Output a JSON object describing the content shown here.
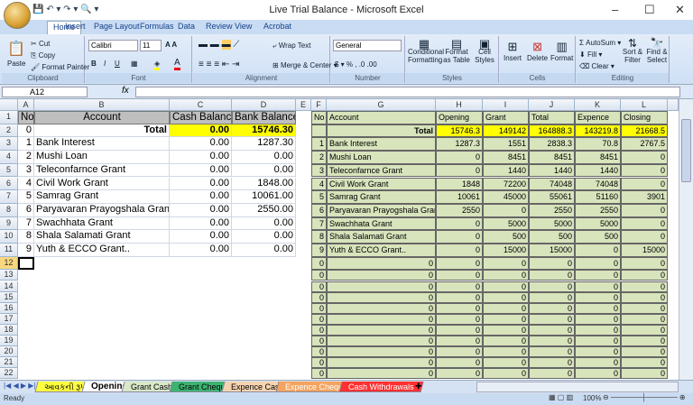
{
  "window": {
    "title": "Live Trial Balance - Microsoft Excel"
  },
  "ribbon_tabs": [
    "Home",
    "Insert",
    "Page Layout",
    "Formulas",
    "Data",
    "Review",
    "View",
    "Acrobat"
  ],
  "clipboard": {
    "paste": "Paste",
    "cut": "Cut",
    "copy": "Copy",
    "format_painter": "Format Painter",
    "label": "Clipboard"
  },
  "font": {
    "name": "Calibri",
    "size": "11",
    "label": "Font"
  },
  "alignment": {
    "wrap": "Wrap Text",
    "merge": "Merge & Center",
    "label": "Alignment"
  },
  "number": {
    "format": "General",
    "label": "Number"
  },
  "styles": {
    "conditional": "Conditional Formatting",
    "format_table": "Format as Table",
    "cell_styles": "Cell Styles",
    "label": "Styles"
  },
  "cells": {
    "insert": "Insert",
    "delete": "Delete",
    "format": "Format",
    "label": "Cells"
  },
  "editing": {
    "autosum": "AutoSum",
    "fill": "Fill",
    "clear": "Clear",
    "sort": "Sort & Filter",
    "find": "Find & Select",
    "label": "Editing"
  },
  "formula_bar": {
    "name_box": "A12",
    "fx": "fx",
    "value": ""
  },
  "columns": [
    "A",
    "B",
    "C",
    "D",
    "E",
    "F",
    "G",
    "H",
    "I",
    "J",
    "K",
    "L"
  ],
  "left_table": {
    "headers": [
      "No",
      "Account",
      "Cash Balance",
      "Bank Balance"
    ],
    "total": {
      "no": "0",
      "label": "Total",
      "cash": "0.00",
      "bank": "15746.30"
    },
    "rows": [
      [
        "1",
        "Bank Interest",
        "0.00",
        "1287.30"
      ],
      [
        "2",
        "Mushi Loan",
        "0.00",
        "0.00"
      ],
      [
        "3",
        "Teleconfarnce Grant",
        "0.00",
        "0.00"
      ],
      [
        "4",
        "Civil Work Grant",
        "0.00",
        "1848.00"
      ],
      [
        "5",
        "Samrag Grant",
        "0.00",
        "10061.00"
      ],
      [
        "6",
        "Paryavaran Prayogshala Grant",
        "0.00",
        "2550.00"
      ],
      [
        "7",
        "Swachhata Grant",
        "0.00",
        "0.00"
      ],
      [
        "8",
        "Shala Salamati Grant",
        "0.00",
        "0.00"
      ],
      [
        "9",
        "Yuth & ECCO Grant..",
        "0.00",
        "0.00"
      ]
    ]
  },
  "right_table": {
    "headers": [
      "No",
      "Account",
      "Opening",
      "Grant",
      "Total",
      "Expence",
      "Closing"
    ],
    "total": {
      "label": "Total",
      "values": [
        "15746.3",
        "149142",
        "164888.3",
        "143219.8",
        "21668.5"
      ]
    },
    "rows": [
      [
        "1",
        "Bank Interest",
        "1287.3",
        "1551",
        "2838.3",
        "70.8",
        "2767.5"
      ],
      [
        "2",
        "Mushi Loan",
        "0",
        "8451",
        "8451",
        "8451",
        "0"
      ],
      [
        "3",
        "Teleconfarnce Grant",
        "0",
        "1440",
        "1440",
        "1440",
        "0"
      ],
      [
        "4",
        "Civil Work Grant",
        "1848",
        "72200",
        "74048",
        "74048",
        "0"
      ],
      [
        "5",
        "Samrag Grant",
        "10061",
        "45000",
        "55061",
        "51160",
        "3901"
      ],
      [
        "6",
        "Paryavaran Prayogshala Grant",
        "2550",
        "0",
        "2550",
        "2550",
        "0"
      ],
      [
        "7",
        "Swachhata Grant",
        "0",
        "5000",
        "5000",
        "5000",
        "0"
      ],
      [
        "8",
        "Shala Salamati Grant",
        "0",
        "500",
        "500",
        "500",
        "0"
      ],
      [
        "9",
        "Yuth & ECCO Grant..",
        "0",
        "15000",
        "15000",
        "0",
        "15000"
      ]
    ],
    "empty_value": "0"
  },
  "sheet_tabs": [
    {
      "label": "આવકની રૂપરેખા",
      "color": "#ffff40"
    },
    {
      "label": "Opening",
      "color": "#ffffff"
    },
    {
      "label": "Grant Cash",
      "color": "#d8e8c8"
    },
    {
      "label": "Grant Cheque",
      "color": "#3cb371"
    },
    {
      "label": "Expence Cash",
      "color": "#f6d3b0"
    },
    {
      "label": "Expence Cheque",
      "color": "#f4a460"
    },
    {
      "label": "Cash Withdrawals",
      "color": "#ff3030"
    }
  ],
  "status": {
    "ready": "Ready",
    "zoom": "100%"
  },
  "colors": {
    "total_highlight": "#ffff00",
    "green_fill": "#d8e4bc",
    "header_gray": "#bfbfbf"
  }
}
